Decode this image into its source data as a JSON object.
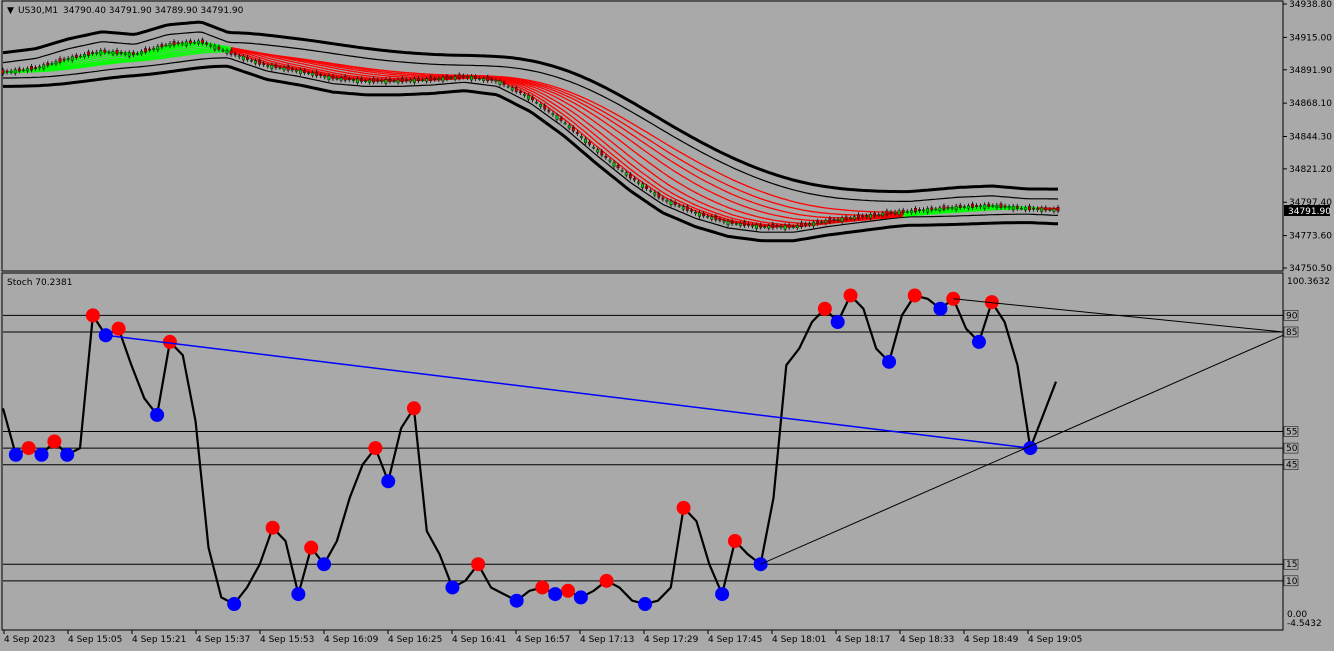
{
  "header": {
    "symbol": "US30,M1",
    "ohlc": "34790.40 34791.90 34789.90 34791.90"
  },
  "price_panel": {
    "y_ticks": [
      "34938.80",
      "34915.00",
      "34891.90",
      "34868.10",
      "34844.30",
      "34821.20",
      "34797.40",
      "34773.60",
      "34750.50"
    ],
    "current_price": "34791.90"
  },
  "stoch_panel": {
    "title": "Stoch 70.2381",
    "top_label": "100.3632",
    "bottom_label": "-4.5432",
    "zero_label": "0.00",
    "levels": [
      "90",
      "85",
      "55",
      "50",
      "45",
      "15",
      "10"
    ]
  },
  "x_axis": {
    "labels": [
      "4 Sep 2023",
      "4 Sep 15:05",
      "4 Sep 15:21",
      "4 Sep 15:37",
      "4 Sep 15:53",
      "4 Sep 16:09",
      "4 Sep 16:25",
      "4 Sep 16:41",
      "4 Sep 16:57",
      "4 Sep 17:13",
      "4 Sep 17:29",
      "4 Sep 17:45",
      "4 Sep 18:01",
      "4 Sep 18:17",
      "4 Sep 18:33",
      "4 Sep 18:49",
      "4 Sep 19:05"
    ]
  },
  "colors": {
    "background": "#a9a9a9",
    "bear_ribbon": "#ff0000",
    "bull_ribbon": "#00ff00",
    "peak_marker": "#ff0000",
    "trough_marker": "#0000ff",
    "stoch_line": "#000000",
    "divergence_line": "#0000ff"
  },
  "chart_data": [
    {
      "type": "line",
      "panel": "price",
      "ylim": [
        34750.5,
        34938.8
      ],
      "series": [
        {
          "values": [
            34890,
            34893,
            34900,
            34905,
            34903,
            34910,
            34912,
            34903,
            34895,
            34891,
            34886,
            34884,
            34884,
            34885,
            34887,
            34884,
            34872,
            34855,
            34835,
            34816,
            34800,
            34790,
            34783,
            34780,
            34780,
            34784,
            34787,
            34790,
            34792,
            34794,
            34795,
            34793,
            34792
          ]
        }
      ]
    },
    {
      "type": "line",
      "panel": "stochastic",
      "ylim": [
        -4.5432,
        100.3632
      ],
      "levels": [
        90,
        85,
        55,
        50,
        45,
        15,
        10
      ],
      "series": [
        {
          "values": [
            62,
            48,
            50,
            48,
            52,
            48,
            50,
            90,
            84,
            86,
            75,
            65,
            60,
            82,
            78,
            58,
            20,
            5,
            3,
            8,
            15,
            26,
            22,
            6,
            20,
            15,
            22,
            35,
            45,
            50,
            40,
            56,
            62,
            25,
            18,
            8,
            10,
            15,
            8,
            6,
            4,
            7,
            8,
            6,
            7,
            5,
            7,
            10,
            8,
            4,
            3,
            4,
            8,
            32,
            28,
            15,
            6,
            22,
            18,
            15,
            35,
            75,
            80,
            88,
            92,
            88,
            96,
            92,
            80,
            76,
            90,
            96,
            95,
            92,
            95,
            86,
            82,
            94,
            88,
            75,
            50,
            60,
            70
          ]
        }
      ],
      "peaks": [
        {
          "x": "4 Sep 2023",
          "y": 52
        },
        {
          "x": "4 Sep 15:05",
          "y": 92
        },
        {
          "x": "4 Sep 15:21",
          "y": 85
        },
        {
          "x": "4 Sep 15:53",
          "y": 16
        },
        {
          "x": "4 Sep 15:53",
          "y": 26
        },
        {
          "x": "4 Sep 16:09",
          "y": 23
        },
        {
          "x": "4 Sep 16:09",
          "y": 27
        },
        {
          "x": "4 Sep 16:25",
          "y": 52
        },
        {
          "x": "4 Sep 16:25",
          "y": 62
        },
        {
          "x": "4 Sep 16:41",
          "y": 15
        },
        {
          "x": "4 Sep 16:57",
          "y": 9
        },
        {
          "x": "4 Sep 17:13",
          "y": 8
        },
        {
          "x": "4 Sep 17:29",
          "y": 4
        },
        {
          "x": "4 Sep 17:45",
          "y": 27
        },
        {
          "x": "4 Sep 17:45",
          "y": 21
        },
        {
          "x": "4 Sep 18:01",
          "y": 77
        },
        {
          "x": "4 Sep 18:17",
          "y": 93
        },
        {
          "x": "4 Sep 18:17",
          "y": 96
        },
        {
          "x": "4 Sep 18:33",
          "y": 96
        },
        {
          "x": "4 Sep 18:33",
          "y": 96
        },
        {
          "x": "4 Sep 18:49",
          "y": 94
        }
      ],
      "troughs": [
        {
          "x": "4 Sep 2023",
          "y": 48
        },
        {
          "x": "4 Sep 15:05",
          "y": 48
        },
        {
          "x": "4 Sep 15:05",
          "y": 70
        },
        {
          "x": "4 Sep 15:21",
          "y": 63
        },
        {
          "x": "4 Sep 15:37",
          "y": 5
        },
        {
          "x": "4 Sep 15:37",
          "y": 3
        },
        {
          "x": "4 Sep 15:53",
          "y": 4
        },
        {
          "x": "4 Sep 16:09",
          "y": 14
        },
        {
          "x": "4 Sep 16:25",
          "y": 42
        },
        {
          "x": "4 Sep 16:25",
          "y": 35
        },
        {
          "x": "4 Sep 16:41",
          "y": 13
        },
        {
          "x": "4 Sep 16:41",
          "y": 5
        },
        {
          "x": "4 Sep 16:57",
          "y": 4
        },
        {
          "x": "4 Sep 16:57",
          "y": 2
        },
        {
          "x": "4 Sep 17:13",
          "y": 3
        },
        {
          "x": "4 Sep 17:13",
          "y": 3
        },
        {
          "x": "4 Sep 17:29",
          "y": 3
        },
        {
          "x": "4 Sep 17:45",
          "y": 5
        },
        {
          "x": "4 Sep 17:45",
          "y": 13
        },
        {
          "x": "4 Sep 18:17",
          "y": 81
        },
        {
          "x": "4 Sep 18:33",
          "y": 80
        },
        {
          "x": "4 Sep 18:49",
          "y": 82
        },
        {
          "x": "4 Sep 19:05",
          "y": 50
        }
      ]
    }
  ]
}
